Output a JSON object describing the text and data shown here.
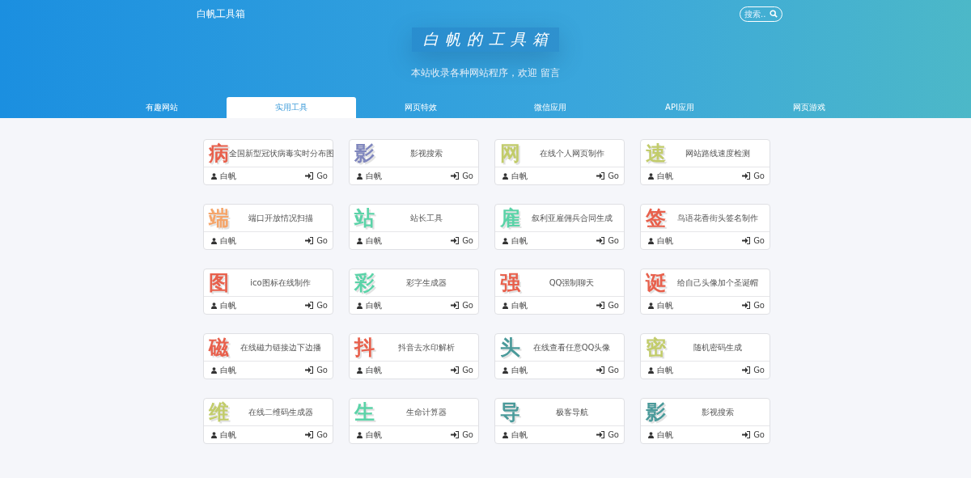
{
  "header": {
    "site_name": "白帆工具箱",
    "search": {
      "placeholder": "搜索.."
    },
    "title": "白帆的工具箱",
    "subtitle": "本站收录各种网站程序，欢迎 留言"
  },
  "tabs": [
    {
      "label": "有趣网站",
      "selected": false
    },
    {
      "label": "实用工具",
      "selected": true
    },
    {
      "label": "网页特效",
      "selected": false
    },
    {
      "label": "微信应用",
      "selected": false
    },
    {
      "label": "API应用",
      "selected": false
    },
    {
      "label": "网页游戏",
      "selected": false
    }
  ],
  "cards": [
    {
      "glyph": "病",
      "color": "#e8604c",
      "title": "全国新型冠状病毒实时分布图",
      "author": "白帆",
      "action": "Go"
    },
    {
      "glyph": "影",
      "color": "#7f86bd",
      "title": "影视搜索",
      "author": "白帆",
      "action": "Go"
    },
    {
      "glyph": "网",
      "color": "#c2cc6b",
      "title": "在线个人网页制作",
      "author": "白帆",
      "action": "Go"
    },
    {
      "glyph": "速",
      "color": "#c2cc6b",
      "title": "网站路线速度检测",
      "author": "白帆",
      "action": "Go"
    },
    {
      "glyph": "端",
      "color": "#f5a56a",
      "title": "端口开放情况扫描",
      "author": "白帆",
      "action": "Go"
    },
    {
      "glyph": "站",
      "color": "#5bd3a8",
      "title": "站长工具",
      "author": "白帆",
      "action": "Go"
    },
    {
      "glyph": "雇",
      "color": "#5bd3a8",
      "title": "叙利亚雇佣兵合同生成",
      "author": "白帆",
      "action": "Go"
    },
    {
      "glyph": "签",
      "color": "#e8604c",
      "title": "鸟语花香街头签名制作",
      "author": "白帆",
      "action": "Go"
    },
    {
      "glyph": "图",
      "color": "#e8604c",
      "title": "ico图标在线制作",
      "author": "白帆",
      "action": "Go"
    },
    {
      "glyph": "彩",
      "color": "#5bd3a8",
      "title": "彩字生成器",
      "author": "白帆",
      "action": "Go"
    },
    {
      "glyph": "强",
      "color": "#e8604c",
      "title": "QQ强制聊天",
      "author": "白帆",
      "action": "Go"
    },
    {
      "glyph": "诞",
      "color": "#e8604c",
      "title": "给自己头像加个圣诞帽",
      "author": "白帆",
      "action": "Go"
    },
    {
      "glyph": "磁",
      "color": "#e8604c",
      "title": "在线磁力链接边下边播",
      "author": "白帆",
      "action": "Go"
    },
    {
      "glyph": "抖",
      "color": "#e8604c",
      "title": "抖音去水印解析",
      "author": "白帆",
      "action": "Go"
    },
    {
      "glyph": "头",
      "color": "#4a9a9a",
      "title": "在线查看任意QQ头像",
      "author": "白帆",
      "action": "Go"
    },
    {
      "glyph": "密",
      "color": "#c2cc6b",
      "title": "随机密码生成",
      "author": "白帆",
      "action": "Go"
    },
    {
      "glyph": "维",
      "color": "#c2cc6b",
      "title": "在线二维码生成器",
      "author": "白帆",
      "action": "Go"
    },
    {
      "glyph": "生",
      "color": "#5bd3a8",
      "title": "生命计算器",
      "author": "白帆",
      "action": "Go"
    },
    {
      "glyph": "导",
      "color": "#4a9a9a",
      "title": "极客导航",
      "author": "白帆",
      "action": "Go"
    },
    {
      "glyph": "影",
      "color": "#4a9a9a",
      "title": "影视搜索",
      "author": "白帆",
      "action": "Go"
    }
  ]
}
